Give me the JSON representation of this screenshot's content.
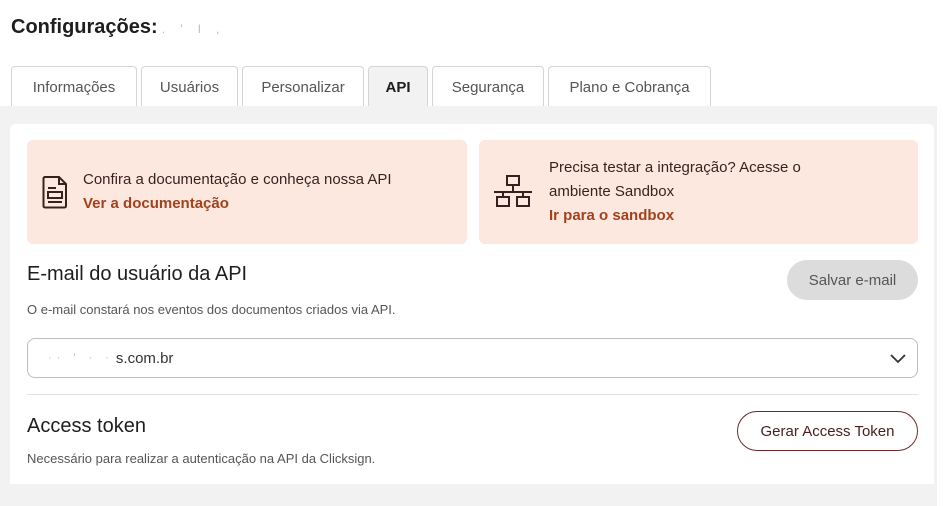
{
  "header": {
    "title": "Configurações:",
    "title_redacted": ". ' l ,"
  },
  "tabs": [
    {
      "label": "Informações",
      "active": false
    },
    {
      "label": "Usuários",
      "active": false
    },
    {
      "label": "Personalizar",
      "active": false
    },
    {
      "label": "API",
      "active": true
    },
    {
      "label": "Segurança",
      "active": false
    },
    {
      "label": "Plano e Cobrança",
      "active": false
    }
  ],
  "cards": {
    "docs": {
      "text": "Confira a documentação e conheça nossa API",
      "link": "Ver a documentação",
      "icon": "document-icon"
    },
    "sandbox": {
      "text_line1": "Precisa testar a integração? Acesse o",
      "text_line2": "ambiente Sandbox",
      "link": "Ir para o sandbox",
      "icon": "network-icon"
    }
  },
  "email_section": {
    "title": "E-mail do usuário da API",
    "description": "O e-mail constará nos eventos dos documentos criados via API.",
    "save_button": "Salvar e-mail",
    "selected_value_redacted": "·· ' · ·",
    "selected_value_suffix": "s.com.br"
  },
  "token_section": {
    "title": "Access token",
    "description": "Necessário para realizar a autenticação na API da Clicksign.",
    "generate_button": "Gerar Access Token"
  },
  "colors": {
    "card_bg": "#fde8df",
    "link": "#a0421d",
    "outline_button": "#6b2a2a"
  }
}
